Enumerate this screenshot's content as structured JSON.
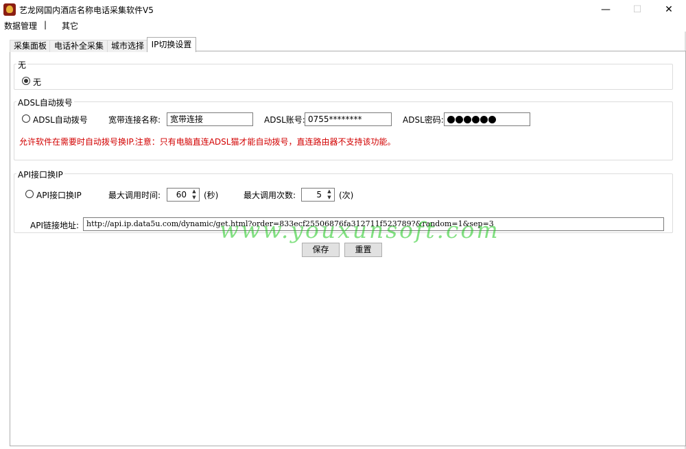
{
  "window": {
    "title": "艺龙网国内酒店名称电话采集软件V5",
    "minimize_glyph": "—",
    "maximize_glyph": "☐",
    "close_glyph": "✕"
  },
  "menu": {
    "items": [
      "数据管理",
      "|",
      "其它"
    ]
  },
  "tabs": [
    "采集面板",
    "电话补全采集",
    "城市选择",
    "IP切换设置"
  ],
  "active_tab": "IP切换设置",
  "group_none": {
    "title": "无",
    "radio_label": "无"
  },
  "group_adsl": {
    "title": "ADSL自动拨号",
    "radio_label": "ADSL自动拨号",
    "conn_name_label": "宽带连接名称:",
    "conn_name_value": "宽带连接",
    "account_label": "ADSL账号:",
    "account_value": "0755********",
    "password_label": "ADSL密码:",
    "password_dot_count": 6,
    "note": "允许软件在需要时自动拨号换IP.注意：只有电脑直连ADSL猫才能自动拨号，直连路由器不支持该功能。"
  },
  "group_api": {
    "title": "API接口换IP",
    "radio_label": "API接口换IP",
    "max_time_label": "最大调用时间:",
    "max_time_value": "60",
    "max_time_unit": "(秒)",
    "max_count_label": "最大调用次数:",
    "max_count_value": "5",
    "max_count_unit": "(次)",
    "url_label": "API链接地址:",
    "url_value": "http://api.ip.data5u.com/dynamic/get.html?order=833ecf25506876fa312711f523789?&random=1&sep=3"
  },
  "buttons": {
    "save": "保存",
    "reset": "重置"
  },
  "watermark": "www.youxunsoft.com",
  "colors": {
    "note_red": "#d20000",
    "watermark_green": "#1ec81e"
  }
}
